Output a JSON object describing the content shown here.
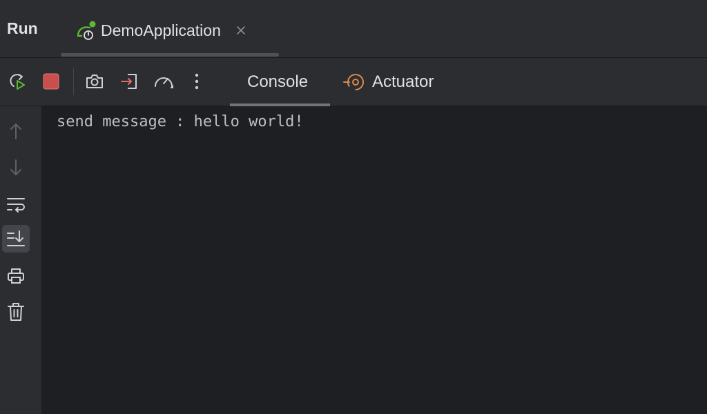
{
  "header": {
    "panel_title": "Run",
    "run_tab": {
      "label": "DemoApplication",
      "icon": "spring-boot-run-icon",
      "status_color": "#5fb832"
    },
    "close_icon": "close-icon"
  },
  "toolbar": {
    "buttons": [
      {
        "name": "rerun-icon"
      },
      {
        "name": "stop-icon",
        "color": "#c94f4f"
      },
      {
        "name": "camera-icon"
      },
      {
        "name": "exit-icon",
        "color": "#e06c6c"
      },
      {
        "name": "speedometer-icon"
      },
      {
        "name": "more-options-icon"
      }
    ],
    "tabs": [
      {
        "label": "Console",
        "active": true
      },
      {
        "label": "Actuator",
        "icon": "actuator-icon",
        "icon_color": "#d98b4f"
      }
    ]
  },
  "gutter": {
    "buttons": [
      {
        "name": "arrow-up-icon"
      },
      {
        "name": "arrow-down-icon"
      },
      {
        "name": "soft-wrap-icon"
      },
      {
        "name": "scroll-to-end-icon",
        "active": true
      },
      {
        "name": "print-icon"
      },
      {
        "name": "trash-icon"
      }
    ]
  },
  "console": {
    "lines": [
      "send message : hello world!"
    ]
  }
}
